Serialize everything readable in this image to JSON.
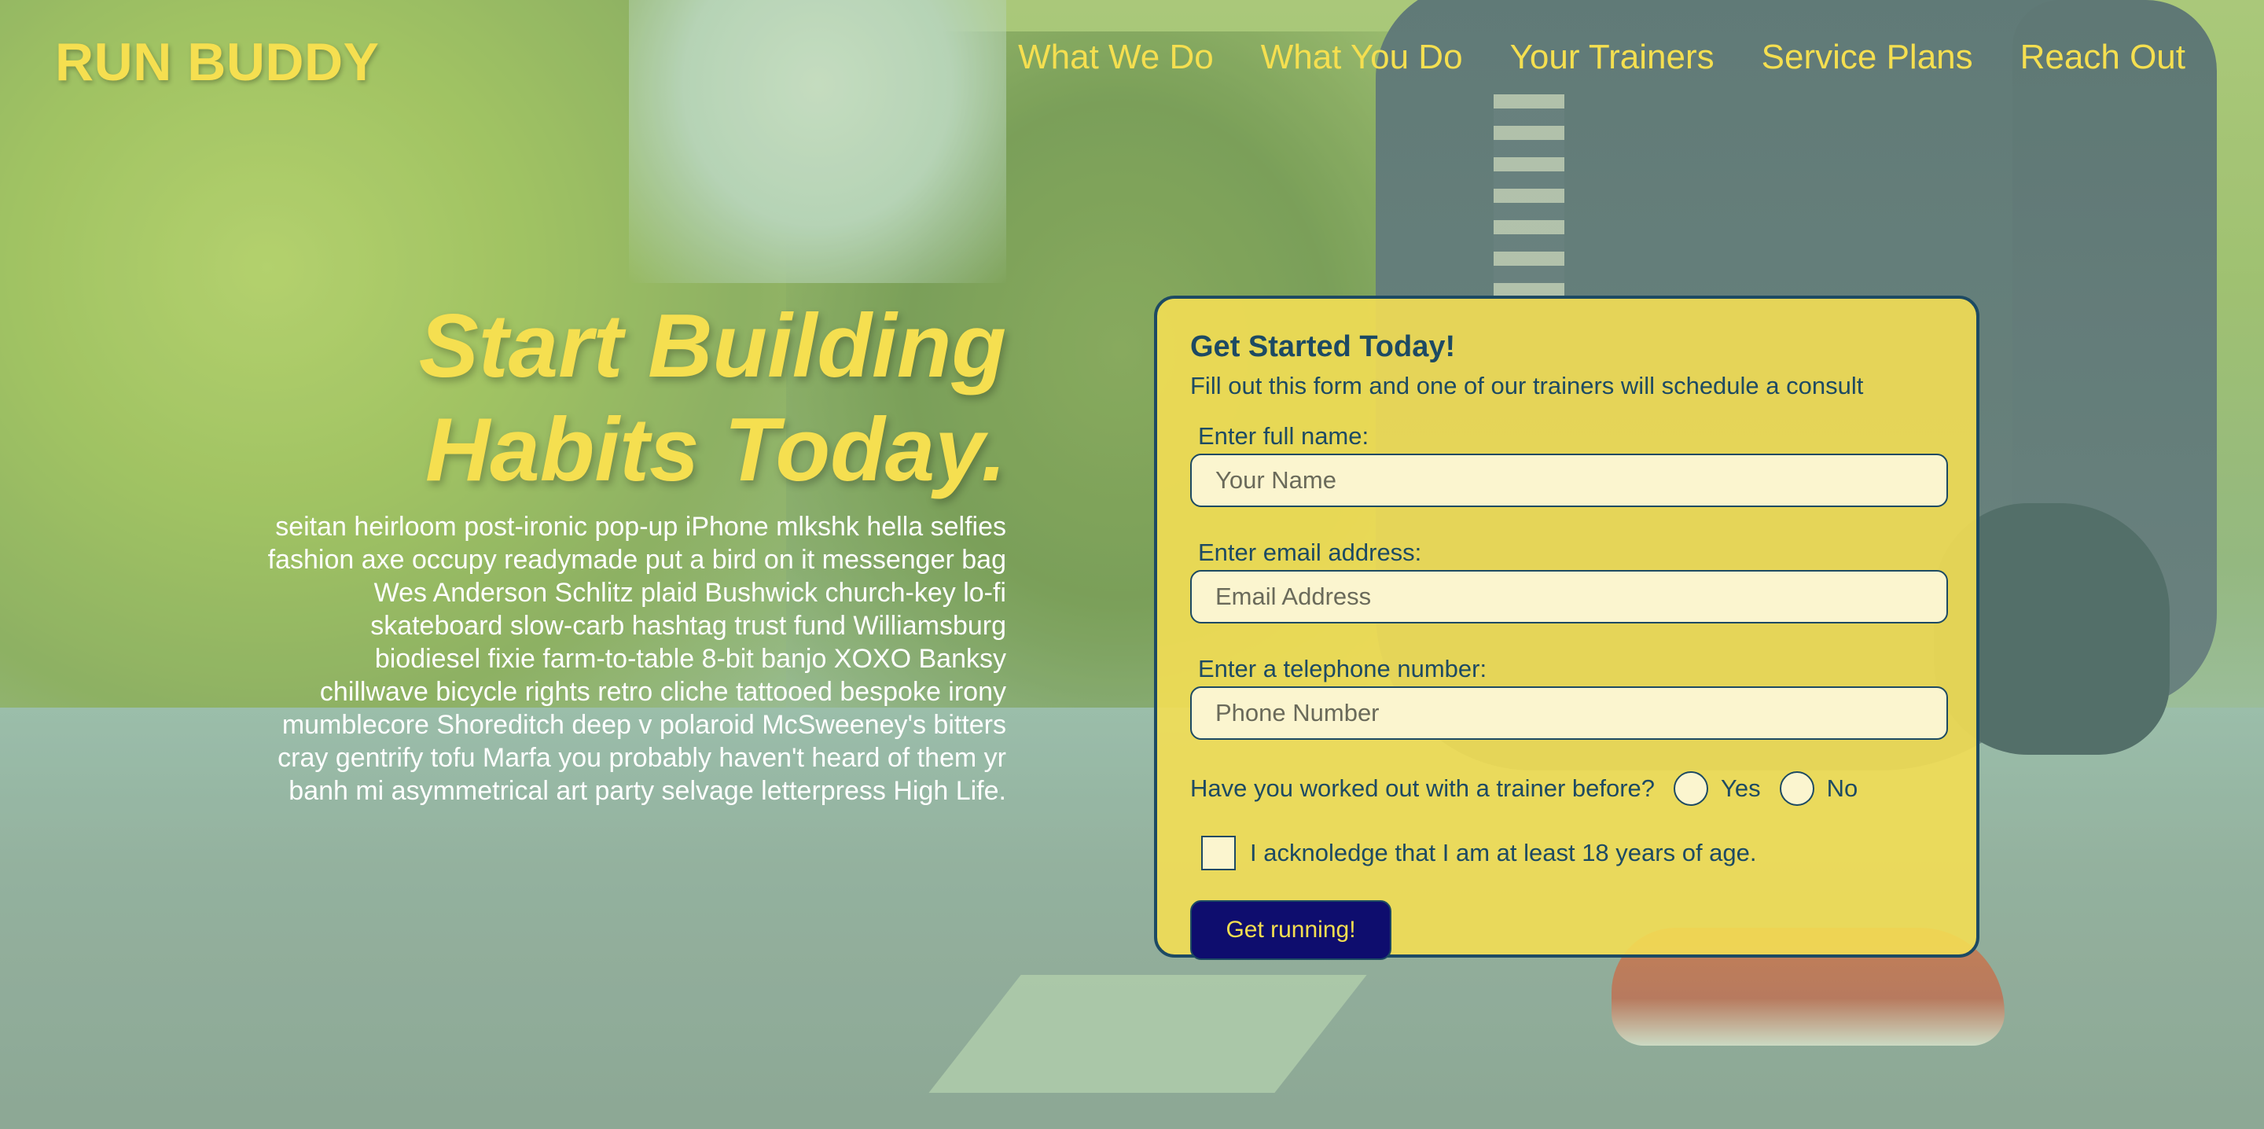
{
  "header": {
    "logo": "RUN BUDDY",
    "nav": [
      {
        "label": "What We Do"
      },
      {
        "label": "What You Do"
      },
      {
        "label": "Your Trainers"
      },
      {
        "label": "Service Plans"
      },
      {
        "label": "Reach Out"
      }
    ]
  },
  "hero": {
    "heading_line1": "Start Building",
    "heading_line2": "Habits Today.",
    "body": "seitan heirloom post-ironic pop-up iPhone mlkshk hella selfies fashion axe occupy readymade put a bird on it messenger bag Wes Anderson Schlitz plaid Bushwick church-key lo-fi skateboard slow-carb hashtag trust fund Williamsburg biodiesel fixie farm-to-table 8-bit banjo XOXO Banksy chillwave bicycle rights retro cliche tattooed bespoke irony mumblecore Shoreditch deep v polaroid McSweeney's bitters cray gentrify tofu Marfa you probably haven't heard of them yr banh mi asymmetrical art party selvage letterpress High Life."
  },
  "form": {
    "title": "Get Started Today!",
    "subtitle": "Fill out this form and one of our trainers will schedule a consult",
    "name_label": "Enter full name:",
    "name_placeholder": "Your Name",
    "email_label": "Enter email address:",
    "email_placeholder": "Email Address",
    "phone_label": "Enter a telephone number:",
    "phone_placeholder": "Phone Number",
    "trainer_question": "Have you worked out with a trainer before?",
    "yes_label": "Yes",
    "no_label": "No",
    "age_ack": "I acknoledge that I am at least 18 years of age.",
    "submit_label": "Get running!"
  },
  "colors": {
    "accent_yellow": "#f5df50",
    "navy": "#1d4a63",
    "button": "#0e0d6e"
  }
}
